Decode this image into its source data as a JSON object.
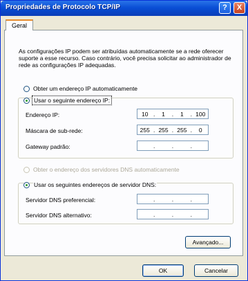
{
  "window": {
    "title": "Propriedades de Protocolo TCP/IP",
    "help_label": "?",
    "close_label": "X"
  },
  "tab": {
    "label": "Geral"
  },
  "description": "As configurações IP podem ser atribuídas automaticamente se a rede oferecer suporte a esse recurso. Caso contrário, você precisa solicitar ao administrador de rede as configurações IP adequadas.",
  "ip_options": {
    "auto_label": "Obter um endereço IP automaticamente",
    "manual_label": "Usar o seguinte endereço IP:",
    "selected": "manual"
  },
  "ip_fields": {
    "ip_label": "Endereço IP:",
    "ip_value": [
      "10",
      "1",
      "1",
      "100"
    ],
    "mask_label": "Máscara de sub-rede:",
    "mask_value": [
      "255",
      "255",
      "255",
      "0"
    ],
    "gateway_label": "Gateway padrão:",
    "gateway_value": [
      "",
      "",
      "",
      ""
    ]
  },
  "dns_options": {
    "auto_label": "Obter o endereço dos servidores DNS automaticamente",
    "manual_label": "Usar os seguintes endereços de servidor DNS:",
    "selected": "manual"
  },
  "dns_fields": {
    "preferred_label": "Servidor DNS preferencial:",
    "preferred_value": [
      "",
      "",
      "",
      ""
    ],
    "alternate_label": "Servidor DNS alternativo:",
    "alternate_value": [
      "",
      "",
      "",
      ""
    ]
  },
  "buttons": {
    "advanced": "Avançado...",
    "ok": "OK",
    "cancel": "Cancelar"
  }
}
